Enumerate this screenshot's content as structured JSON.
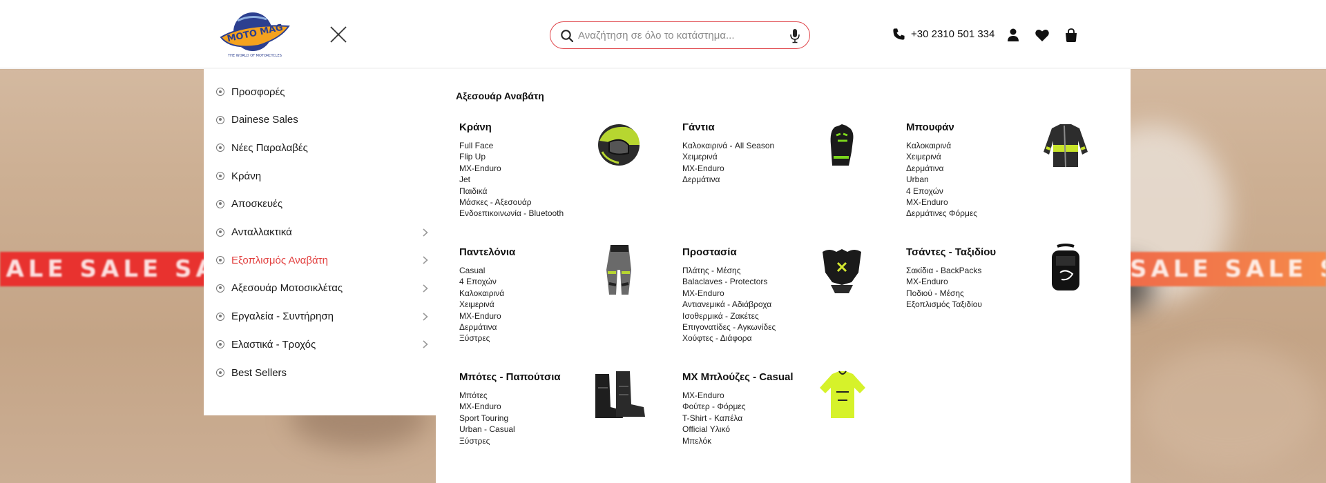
{
  "header": {
    "logo_text": "MOTO MAG",
    "logo_tagline": "THE WORLD OF MOTORCYCLES",
    "search_placeholder": "Αναζήτηση σε όλο το κατάστημα...",
    "phone": "+30 2310 501 334",
    "search_border_color": "#e0464b"
  },
  "background": {
    "banner_text": "SALE SALE SALE SALE",
    "banner_text_right": "SALE SALE SALE S"
  },
  "menu": {
    "items": [
      {
        "label": "Προσφορές",
        "has_children": false,
        "active": false
      },
      {
        "label": "Dainese Sales",
        "has_children": false,
        "active": false
      },
      {
        "label": "Νέες Παραλαβές",
        "has_children": false,
        "active": false
      },
      {
        "label": "Κράνη",
        "has_children": false,
        "active": false
      },
      {
        "label": "Αποσκευές",
        "has_children": false,
        "active": false
      },
      {
        "label": "Ανταλλακτικά",
        "has_children": true,
        "active": false
      },
      {
        "label": "Εξοπλισμός Αναβάτη",
        "has_children": true,
        "active": true
      },
      {
        "label": "Αξεσουάρ Μοτοσικλέτας",
        "has_children": true,
        "active": false
      },
      {
        "label": "Εργαλεία - Συντήρηση",
        "has_children": true,
        "active": false
      },
      {
        "label": "Ελαστικά - Τροχός",
        "has_children": true,
        "active": false
      },
      {
        "label": "Best Sellers",
        "has_children": false,
        "active": false
      }
    ],
    "active_color": "#e2403f"
  },
  "mega": {
    "title": "Αξεσουάρ Αναβάτη",
    "categories": [
      {
        "title": "Κράνη",
        "icon": "helmet-icon",
        "links": [
          "Full Face",
          "Flip Up",
          "MX-Enduro",
          "Jet",
          "Παιδικά",
          "Μάσκες - Αξεσουάρ",
          "Ενδοεπικοινωνία - Bluetooth"
        ]
      },
      {
        "title": "Γάντια",
        "icon": "gloves-icon",
        "links": [
          "Καλοκαιρινά - All Season",
          "Χειμερινά",
          "MX-Enduro",
          "Δερμάτινα"
        ]
      },
      {
        "title": "Μπουφάν",
        "icon": "jacket-icon",
        "links": [
          "Καλοκαιρινά",
          "Χειμερινά",
          "Δερμάτινα",
          "Urban",
          "4 Εποχών",
          "MX-Enduro",
          "Δερμάτινες Φόρμες"
        ]
      },
      {
        "title": "Παντελόνια",
        "icon": "pants-icon",
        "links": [
          "Casual",
          "4 Εποχών",
          "Καλοκαιρινά",
          "Χειμερινά",
          "MX-Enduro",
          "Δερμάτινα",
          "Ξύστρες"
        ]
      },
      {
        "title": "Προστασία",
        "icon": "chest-protector-icon",
        "links": [
          "Πλάτης - Μέσης",
          "Balaclaves - Protectors",
          "MX-Enduro",
          "Αντιανεμικά - Αδιάβροχα",
          "Ισοθερμικά - Ζακέτες",
          "Επιγονατίδες - Αγκωνίδες",
          "Χούφτες - Διάφορα"
        ]
      },
      {
        "title": "Τσάντες - Ταξιδίου",
        "icon": "backpack-icon",
        "links": [
          "Σακίδια - BackPacks",
          "MX-Enduro",
          "Ποδιού - Μέσης",
          "Εξοπλισμός Ταξιδίου"
        ]
      },
      {
        "title": "Μπότες - Παπούτσια",
        "icon": "boots-icon",
        "links": [
          "Μπότες",
          "MX-Enduro",
          "Sport Touring",
          "Urban - Casual",
          "Ξύστρες"
        ]
      },
      {
        "title": "MX Μπλούζες - Casual",
        "icon": "mx-jersey-icon",
        "links": [
          "MX-Enduro",
          "Φούτερ - Φόρμες",
          "T-Shirt - Καπέλα",
          "Official Υλικό",
          "Μπελόκ"
        ]
      }
    ]
  }
}
